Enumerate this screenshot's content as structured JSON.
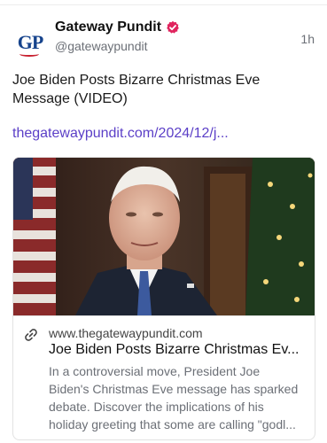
{
  "post": {
    "author": {
      "display_name": "Gateway Pundit",
      "handle": "@gatewaypundit",
      "avatar_text": "GP",
      "verified_icon": "verified-badge-icon"
    },
    "timestamp": "1h",
    "text_lines": [
      "Joe Biden Posts Bizarre Christmas Eve",
      "Message (VIDEO)"
    ],
    "link_text": "thegatewaypundit.com/2024/12/j..."
  },
  "card": {
    "image_description_icon": "news-photo",
    "domain": "www.thegatewaypundit.com",
    "title": "Joe Biden Posts Bizarre Christmas Ev...",
    "description_lines": [
      "In a controversial move, President Joe",
      "Biden's Christmas Eve message has sparked",
      "debate. Discover the implications of his",
      "holiday greeting that some are calling \"godl..."
    ],
    "link_icon": "link-icon"
  },
  "colors": {
    "link": "#5b3fc7",
    "verified": "#e0245e",
    "muted": "#6b6f76",
    "brand_blue": "#16438c"
  }
}
